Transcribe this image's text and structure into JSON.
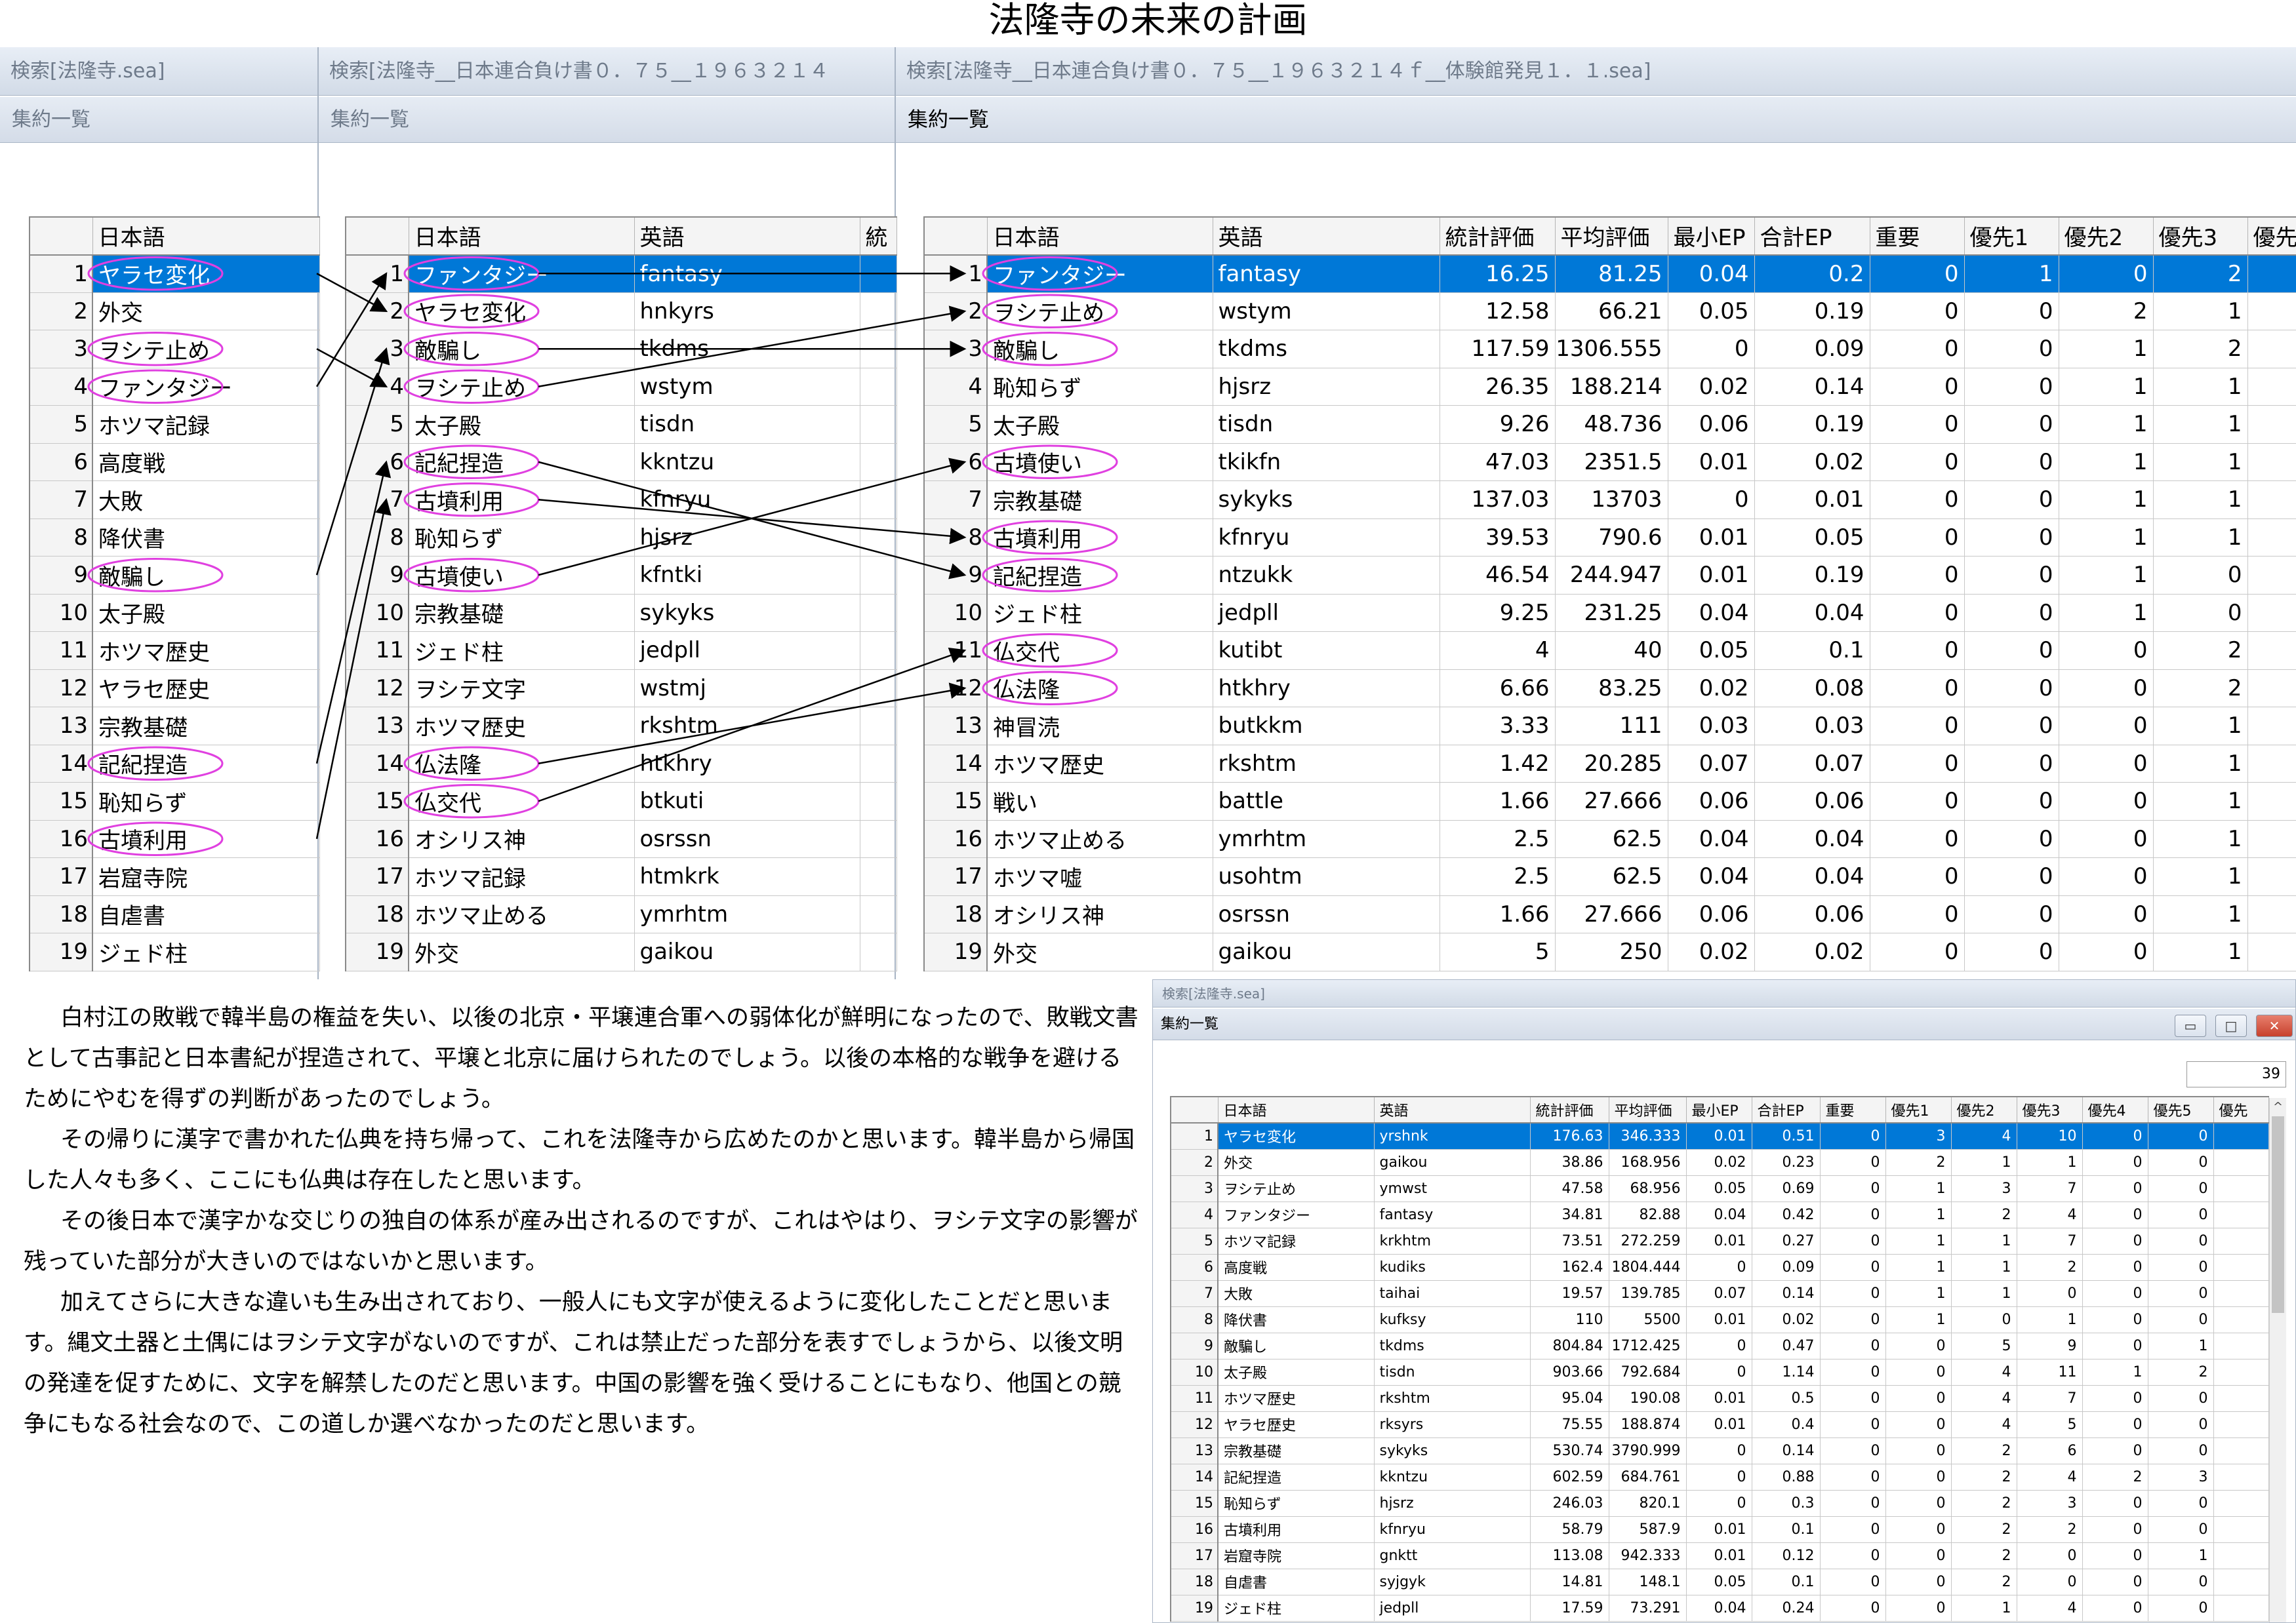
{
  "title": "法隆寺の未来の計画",
  "win1": {
    "search_title": "検索[法隆寺.sea]",
    "summary_title": "集約一覧"
  },
  "win2": {
    "search_title": "検索[法隆寺__日本連合負け書０．７５__１９６３２１４",
    "summary_title": "集約一覧"
  },
  "win3": {
    "search_title": "検索[法隆寺__日本連合負け書０．７５__１９６３２１４ｆ__体験館発見１．１.sea]",
    "summary_title": "集約一覧"
  },
  "win4": {
    "search_title": "検索[法隆寺.sea]",
    "summary_title": "集約一覧",
    "count": "39",
    "btn_min": "▭",
    "btn_max": "□",
    "btn_close": "✕",
    "scroll_up": "^"
  },
  "headers": {
    "jp": "日本語",
    "en": "英語",
    "stat": "統計評価",
    "stat_cut": "統",
    "avg": "平均評価",
    "min_ep": "最小EP",
    "sum_ep": "合計EP",
    "important": "重要",
    "p1": "優先1",
    "p2": "優先2",
    "p3": "優先3",
    "p4": "優先4",
    "p5": "優先5",
    "p_cut": "優先"
  },
  "table1": [
    {
      "no": "1",
      "jp": "ヤラセ変化"
    },
    {
      "no": "2",
      "jp": "外交"
    },
    {
      "no": "3",
      "jp": "ヲシテ止め"
    },
    {
      "no": "4",
      "jp": "ファンタジー"
    },
    {
      "no": "5",
      "jp": "ホツマ記録"
    },
    {
      "no": "6",
      "jp": "高度戦"
    },
    {
      "no": "7",
      "jp": "大敗"
    },
    {
      "no": "8",
      "jp": "降伏書"
    },
    {
      "no": "9",
      "jp": "敵騙し"
    },
    {
      "no": "10",
      "jp": "太子殿"
    },
    {
      "no": "11",
      "jp": "ホツマ歴史"
    },
    {
      "no": "12",
      "jp": "ヤラセ歴史"
    },
    {
      "no": "13",
      "jp": "宗教基礎"
    },
    {
      "no": "14",
      "jp": "記紀捏造"
    },
    {
      "no": "15",
      "jp": "恥知らず"
    },
    {
      "no": "16",
      "jp": "古墳利用"
    },
    {
      "no": "17",
      "jp": "岩窟寺院"
    },
    {
      "no": "18",
      "jp": "自虐書"
    },
    {
      "no": "19",
      "jp": "ジェド柱"
    }
  ],
  "table2": [
    {
      "no": "1",
      "jp": "ファンタジー",
      "en": "fantasy"
    },
    {
      "no": "2",
      "jp": "ヤラセ変化",
      "en": "hnkyrs"
    },
    {
      "no": "3",
      "jp": "敵騙し",
      "en": "tkdms"
    },
    {
      "no": "4",
      "jp": "ヲシテ止め",
      "en": "wstym"
    },
    {
      "no": "5",
      "jp": "太子殿",
      "en": "tisdn"
    },
    {
      "no": "6",
      "jp": "記紀捏造",
      "en": "kkntzu"
    },
    {
      "no": "7",
      "jp": "古墳利用",
      "en": "kfnryu"
    },
    {
      "no": "8",
      "jp": "恥知らず",
      "en": "hjsrz"
    },
    {
      "no": "9",
      "jp": "古墳使い",
      "en": "kfntki"
    },
    {
      "no": "10",
      "jp": "宗教基礎",
      "en": "sykyks"
    },
    {
      "no": "11",
      "jp": "ジェド柱",
      "en": "jedpll"
    },
    {
      "no": "12",
      "jp": "ヲシテ文字",
      "en": "wstmj"
    },
    {
      "no": "13",
      "jp": "ホツマ歴史",
      "en": "rkshtm"
    },
    {
      "no": "14",
      "jp": "仏法隆",
      "en": "htkhry"
    },
    {
      "no": "15",
      "jp": "仏交代",
      "en": "btkuti"
    },
    {
      "no": "16",
      "jp": "オシリス神",
      "en": "osrssn"
    },
    {
      "no": "17",
      "jp": "ホツマ記録",
      "en": "htmkrk"
    },
    {
      "no": "18",
      "jp": "ホツマ止める",
      "en": "ymrhtm"
    },
    {
      "no": "19",
      "jp": "外交",
      "en": "gaikou"
    }
  ],
  "table3": [
    {
      "no": "1",
      "jp": "ファンタジー",
      "en": "fantasy",
      "stat": "16.25",
      "avg": "81.25",
      "min_ep": "0.04",
      "sum_ep": "0.2",
      "imp": "0",
      "p1": "1",
      "p2": "0",
      "p3": "2"
    },
    {
      "no": "2",
      "jp": "ヲシテ止め",
      "en": "wstym",
      "stat": "12.58",
      "avg": "66.21",
      "min_ep": "0.05",
      "sum_ep": "0.19",
      "imp": "0",
      "p1": "0",
      "p2": "2",
      "p3": "1"
    },
    {
      "no": "3",
      "jp": "敵騙し",
      "en": "tkdms",
      "stat": "117.59",
      "avg": "1306.555",
      "min_ep": "0",
      "sum_ep": "0.09",
      "imp": "0",
      "p1": "0",
      "p2": "1",
      "p3": "2"
    },
    {
      "no": "4",
      "jp": "恥知らず",
      "en": "hjsrz",
      "stat": "26.35",
      "avg": "188.214",
      "min_ep": "0.02",
      "sum_ep": "0.14",
      "imp": "0",
      "p1": "0",
      "p2": "1",
      "p3": "1"
    },
    {
      "no": "5",
      "jp": "太子殿",
      "en": "tisdn",
      "stat": "9.26",
      "avg": "48.736",
      "min_ep": "0.06",
      "sum_ep": "0.19",
      "imp": "0",
      "p1": "0",
      "p2": "1",
      "p3": "1"
    },
    {
      "no": "6",
      "jp": "古墳使い",
      "en": "tkikfn",
      "stat": "47.03",
      "avg": "2351.5",
      "min_ep": "0.01",
      "sum_ep": "0.02",
      "imp": "0",
      "p1": "0",
      "p2": "1",
      "p3": "1"
    },
    {
      "no": "7",
      "jp": "宗教基礎",
      "en": "sykyks",
      "stat": "137.03",
      "avg": "13703",
      "min_ep": "0",
      "sum_ep": "0.01",
      "imp": "0",
      "p1": "0",
      "p2": "1",
      "p3": "1"
    },
    {
      "no": "8",
      "jp": "古墳利用",
      "en": "kfnryu",
      "stat": "39.53",
      "avg": "790.6",
      "min_ep": "0.01",
      "sum_ep": "0.05",
      "imp": "0",
      "p1": "0",
      "p2": "1",
      "p3": "1"
    },
    {
      "no": "9",
      "jp": "記紀捏造",
      "en": "ntzukk",
      "stat": "46.54",
      "avg": "244.947",
      "min_ep": "0.01",
      "sum_ep": "0.19",
      "imp": "0",
      "p1": "0",
      "p2": "1",
      "p3": "0"
    },
    {
      "no": "10",
      "jp": "ジェド柱",
      "en": "jedpll",
      "stat": "9.25",
      "avg": "231.25",
      "min_ep": "0.04",
      "sum_ep": "0.04",
      "imp": "0",
      "p1": "0",
      "p2": "1",
      "p3": "0"
    },
    {
      "no": "11",
      "jp": "仏交代",
      "en": "kutibt",
      "stat": "4",
      "avg": "40",
      "min_ep": "0.05",
      "sum_ep": "0.1",
      "imp": "0",
      "p1": "0",
      "p2": "0",
      "p3": "2"
    },
    {
      "no": "12",
      "jp": "仏法隆",
      "en": "htkhry",
      "stat": "6.66",
      "avg": "83.25",
      "min_ep": "0.02",
      "sum_ep": "0.08",
      "imp": "0",
      "p1": "0",
      "p2": "0",
      "p3": "2"
    },
    {
      "no": "13",
      "jp": "神冒涜",
      "en": "butkkm",
      "stat": "3.33",
      "avg": "111",
      "min_ep": "0.03",
      "sum_ep": "0.03",
      "imp": "0",
      "p1": "0",
      "p2": "0",
      "p3": "1"
    },
    {
      "no": "14",
      "jp": "ホツマ歴史",
      "en": "rkshtm",
      "stat": "1.42",
      "avg": "20.285",
      "min_ep": "0.07",
      "sum_ep": "0.07",
      "imp": "0",
      "p1": "0",
      "p2": "0",
      "p3": "1"
    },
    {
      "no": "15",
      "jp": "戦い",
      "en": "battle",
      "stat": "1.66",
      "avg": "27.666",
      "min_ep": "0.06",
      "sum_ep": "0.06",
      "imp": "0",
      "p1": "0",
      "p2": "0",
      "p3": "1"
    },
    {
      "no": "16",
      "jp": "ホツマ止める",
      "en": "ymrhtm",
      "stat": "2.5",
      "avg": "62.5",
      "min_ep": "0.04",
      "sum_ep": "0.04",
      "imp": "0",
      "p1": "0",
      "p2": "0",
      "p3": "1"
    },
    {
      "no": "17",
      "jp": "ホツマ嘘",
      "en": "usohtm",
      "stat": "2.5",
      "avg": "62.5",
      "min_ep": "0.04",
      "sum_ep": "0.04",
      "imp": "0",
      "p1": "0",
      "p2": "0",
      "p3": "1"
    },
    {
      "no": "18",
      "jp": "オシリス神",
      "en": "osrssn",
      "stat": "1.66",
      "avg": "27.666",
      "min_ep": "0.06",
      "sum_ep": "0.06",
      "imp": "0",
      "p1": "0",
      "p2": "0",
      "p3": "1"
    },
    {
      "no": "19",
      "jp": "外交",
      "en": "gaikou",
      "stat": "5",
      "avg": "250",
      "min_ep": "0.02",
      "sum_ep": "0.02",
      "imp": "0",
      "p1": "0",
      "p2": "0",
      "p3": "1"
    }
  ],
  "table4": [
    {
      "no": "1",
      "jp": "ヤラセ変化",
      "en": "yrshnk",
      "stat": "176.63",
      "avg": "346.333",
      "min_ep": "0.01",
      "sum_ep": "0.51",
      "imp": "0",
      "p1": "3",
      "p2": "4",
      "p3": "10",
      "p4": "0",
      "p5": "0"
    },
    {
      "no": "2",
      "jp": "外交",
      "en": "gaikou",
      "stat": "38.86",
      "avg": "168.956",
      "min_ep": "0.02",
      "sum_ep": "0.23",
      "imp": "0",
      "p1": "2",
      "p2": "1",
      "p3": "1",
      "p4": "0",
      "p5": "0"
    },
    {
      "no": "3",
      "jp": "ヲシテ止め",
      "en": "ymwst",
      "stat": "47.58",
      "avg": "68.956",
      "min_ep": "0.05",
      "sum_ep": "0.69",
      "imp": "0",
      "p1": "1",
      "p2": "3",
      "p3": "7",
      "p4": "0",
      "p5": "0"
    },
    {
      "no": "4",
      "jp": "ファンタジー",
      "en": "fantasy",
      "stat": "34.81",
      "avg": "82.88",
      "min_ep": "0.04",
      "sum_ep": "0.42",
      "imp": "0",
      "p1": "1",
      "p2": "2",
      "p3": "4",
      "p4": "0",
      "p5": "0"
    },
    {
      "no": "5",
      "jp": "ホツマ記録",
      "en": "krkhtm",
      "stat": "73.51",
      "avg": "272.259",
      "min_ep": "0.01",
      "sum_ep": "0.27",
      "imp": "0",
      "p1": "1",
      "p2": "1",
      "p3": "7",
      "p4": "0",
      "p5": "0"
    },
    {
      "no": "6",
      "jp": "高度戦",
      "en": "kudiks",
      "stat": "162.4",
      "avg": "1804.444",
      "min_ep": "0",
      "sum_ep": "0.09",
      "imp": "0",
      "p1": "1",
      "p2": "1",
      "p3": "2",
      "p4": "0",
      "p5": "0"
    },
    {
      "no": "7",
      "jp": "大敗",
      "en": "taihai",
      "stat": "19.57",
      "avg": "139.785",
      "min_ep": "0.07",
      "sum_ep": "0.14",
      "imp": "0",
      "p1": "1",
      "p2": "1",
      "p3": "0",
      "p4": "0",
      "p5": "0"
    },
    {
      "no": "8",
      "jp": "降伏書",
      "en": "kufksy",
      "stat": "110",
      "avg": "5500",
      "min_ep": "0.01",
      "sum_ep": "0.02",
      "imp": "0",
      "p1": "1",
      "p2": "0",
      "p3": "1",
      "p4": "0",
      "p5": "0"
    },
    {
      "no": "9",
      "jp": "敵騙し",
      "en": "tkdms",
      "stat": "804.84",
      "avg": "1712.425",
      "min_ep": "0",
      "sum_ep": "0.47",
      "imp": "0",
      "p1": "0",
      "p2": "5",
      "p3": "9",
      "p4": "0",
      "p5": "1"
    },
    {
      "no": "10",
      "jp": "太子殿",
      "en": "tisdn",
      "stat": "903.66",
      "avg": "792.684",
      "min_ep": "0",
      "sum_ep": "1.14",
      "imp": "0",
      "p1": "0",
      "p2": "4",
      "p3": "11",
      "p4": "1",
      "p5": "2"
    },
    {
      "no": "11",
      "jp": "ホツマ歴史",
      "en": "rkshtm",
      "stat": "95.04",
      "avg": "190.08",
      "min_ep": "0.01",
      "sum_ep": "0.5",
      "imp": "0",
      "p1": "0",
      "p2": "4",
      "p3": "7",
      "p4": "0",
      "p5": "0"
    },
    {
      "no": "12",
      "jp": "ヤラセ歴史",
      "en": "rksyrs",
      "stat": "75.55",
      "avg": "188.874",
      "min_ep": "0.01",
      "sum_ep": "0.4",
      "imp": "0",
      "p1": "0",
      "p2": "4",
      "p3": "5",
      "p4": "0",
      "p5": "0"
    },
    {
      "no": "13",
      "jp": "宗教基礎",
      "en": "sykyks",
      "stat": "530.74",
      "avg": "3790.999",
      "min_ep": "0",
      "sum_ep": "0.14",
      "imp": "0",
      "p1": "0",
      "p2": "2",
      "p3": "6",
      "p4": "0",
      "p5": "0"
    },
    {
      "no": "14",
      "jp": "記紀捏造",
      "en": "kkntzu",
      "stat": "602.59",
      "avg": "684.761",
      "min_ep": "0",
      "sum_ep": "0.88",
      "imp": "0",
      "p1": "0",
      "p2": "2",
      "p3": "4",
      "p4": "2",
      "p5": "3"
    },
    {
      "no": "15",
      "jp": "恥知らず",
      "en": "hjsrz",
      "stat": "246.03",
      "avg": "820.1",
      "min_ep": "0",
      "sum_ep": "0.3",
      "imp": "0",
      "p1": "0",
      "p2": "2",
      "p3": "3",
      "p4": "0",
      "p5": "0"
    },
    {
      "no": "16",
      "jp": "古墳利用",
      "en": "kfnryu",
      "stat": "58.79",
      "avg": "587.9",
      "min_ep": "0.01",
      "sum_ep": "0.1",
      "imp": "0",
      "p1": "0",
      "p2": "2",
      "p3": "2",
      "p4": "0",
      "p5": "0"
    },
    {
      "no": "17",
      "jp": "岩窟寺院",
      "en": "gnktt",
      "stat": "113.08",
      "avg": "942.333",
      "min_ep": "0.01",
      "sum_ep": "0.12",
      "imp": "0",
      "p1": "0",
      "p2": "2",
      "p3": "0",
      "p4": "0",
      "p5": "1"
    },
    {
      "no": "18",
      "jp": "自虐書",
      "en": "syjgyk",
      "stat": "14.81",
      "avg": "148.1",
      "min_ep": "0.05",
      "sum_ep": "0.1",
      "imp": "0",
      "p1": "0",
      "p2": "2",
      "p3": "0",
      "p4": "0",
      "p5": "0"
    },
    {
      "no": "19",
      "jp": "ジェド柱",
      "en": "jedpll",
      "stat": "17.59",
      "avg": "73.291",
      "min_ep": "0.04",
      "sum_ep": "0.24",
      "imp": "0",
      "p1": "0",
      "p2": "1",
      "p3": "4",
      "p4": "0",
      "p5": "0"
    }
  ],
  "paragraphs": [
    "白村江の敗戦で韓半島の権益を失い、以後の北京・平壌連合軍への弱体化が鮮明になったので、敗戦文書として古事記と日本書紀が捏造されて、平壌と北京に届けられたのでしょう。以後の本格的な戦争を避けるためにやむを得ずの判断があったのでしょう。",
    "その帰りに漢字で書かれた仏典を持ち帰って、これを法隆寺から広めたのかと思います。韓半島から帰国した人々も多く、ここにも仏典は存在したと思います。",
    "その後日本で漢字かな交じりの独自の体系が産み出されるのですが、これはやはり、ヲシテ文字の影響が残っていた部分が大きいのではないかと思います。",
    "加えてさらに大きな違いも生み出されており、一般人にも文字が使えるように変化したことだと思います。縄文土器と土偶にはヲシテ文字がないのですが、これは禁止だった部分を表すでしょうから、以後文明の発達を促すために、文字を解禁したのだと思います。中国の影響を強く受けることにもなり、他国との競争にもなる社会なので、この道しか選べなかったのだと思います。"
  ],
  "colors": {
    "selection": "#0078d7",
    "ellipse": "#e040e0",
    "arrow": "#000000",
    "titlebar": "#d8e0ec"
  },
  "ellipses": {
    "table1": [
      1,
      3,
      4,
      9,
      14,
      16
    ],
    "table2": [
      1,
      2,
      3,
      4,
      6,
      7,
      9,
      14,
      15
    ],
    "table3": [
      1,
      2,
      3,
      6,
      8,
      9,
      11,
      12
    ]
  },
  "arrows": [
    {
      "from_table": 1,
      "from_row": 1,
      "to_table": 2,
      "to_row": 2
    },
    {
      "from_table": 1,
      "from_row": 3,
      "to_table": 2,
      "to_row": 4
    },
    {
      "from_table": 1,
      "from_row": 4,
      "to_table": 2,
      "to_row": 1
    },
    {
      "from_table": 1,
      "from_row": 9,
      "to_table": 2,
      "to_row": 3
    },
    {
      "from_table": 1,
      "from_row": 14,
      "to_table": 2,
      "to_row": 6
    },
    {
      "from_table": 1,
      "from_row": 16,
      "to_table": 2,
      "to_row": 7
    },
    {
      "from_table": 2,
      "from_row": 1,
      "to_table": 3,
      "to_row": 1
    },
    {
      "from_table": 2,
      "from_row": 4,
      "to_table": 3,
      "to_row": 2
    },
    {
      "from_table": 2,
      "from_row": 3,
      "to_table": 3,
      "to_row": 3
    },
    {
      "from_table": 2,
      "from_row": 9,
      "to_table": 3,
      "to_row": 6
    },
    {
      "from_table": 2,
      "from_row": 7,
      "to_table": 3,
      "to_row": 8
    },
    {
      "from_table": 2,
      "from_row": 6,
      "to_table": 3,
      "to_row": 9
    },
    {
      "from_table": 2,
      "from_row": 14,
      "to_table": 3,
      "to_row": 12
    },
    {
      "from_table": 2,
      "from_row": 15,
      "to_table": 3,
      "to_row": 11
    }
  ]
}
